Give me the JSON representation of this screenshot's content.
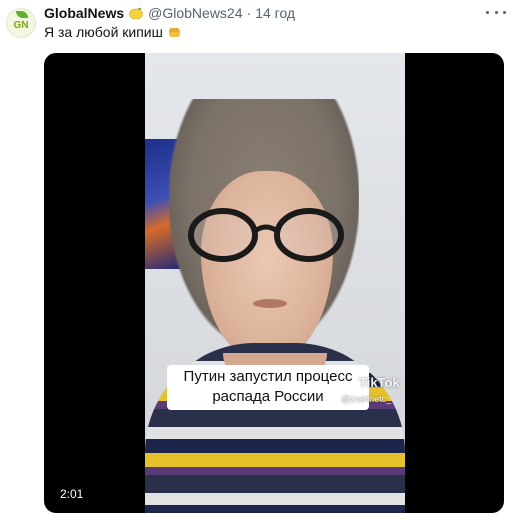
{
  "tweet": {
    "avatar_text": "GN",
    "display_name": "GlobalNews",
    "badge_icon": "lemon-emoji-icon",
    "handle": "@GlobNews24",
    "separator": "·",
    "time": "14 год",
    "more_icon": "more-horizontal-icon",
    "text": "Я за любой кипиш",
    "emoji_icon": "raised-fist-emoji-icon"
  },
  "video": {
    "caption_line1": "Путин запустил процесс",
    "caption_line2": "распада России",
    "watermark_brand": "TikTok",
    "watermark_user": "@zverinetc_",
    "duration": "2:01"
  },
  "colors": {
    "text_primary": "#0f1419",
    "text_secondary": "#536471",
    "media_bg": "#000000"
  }
}
